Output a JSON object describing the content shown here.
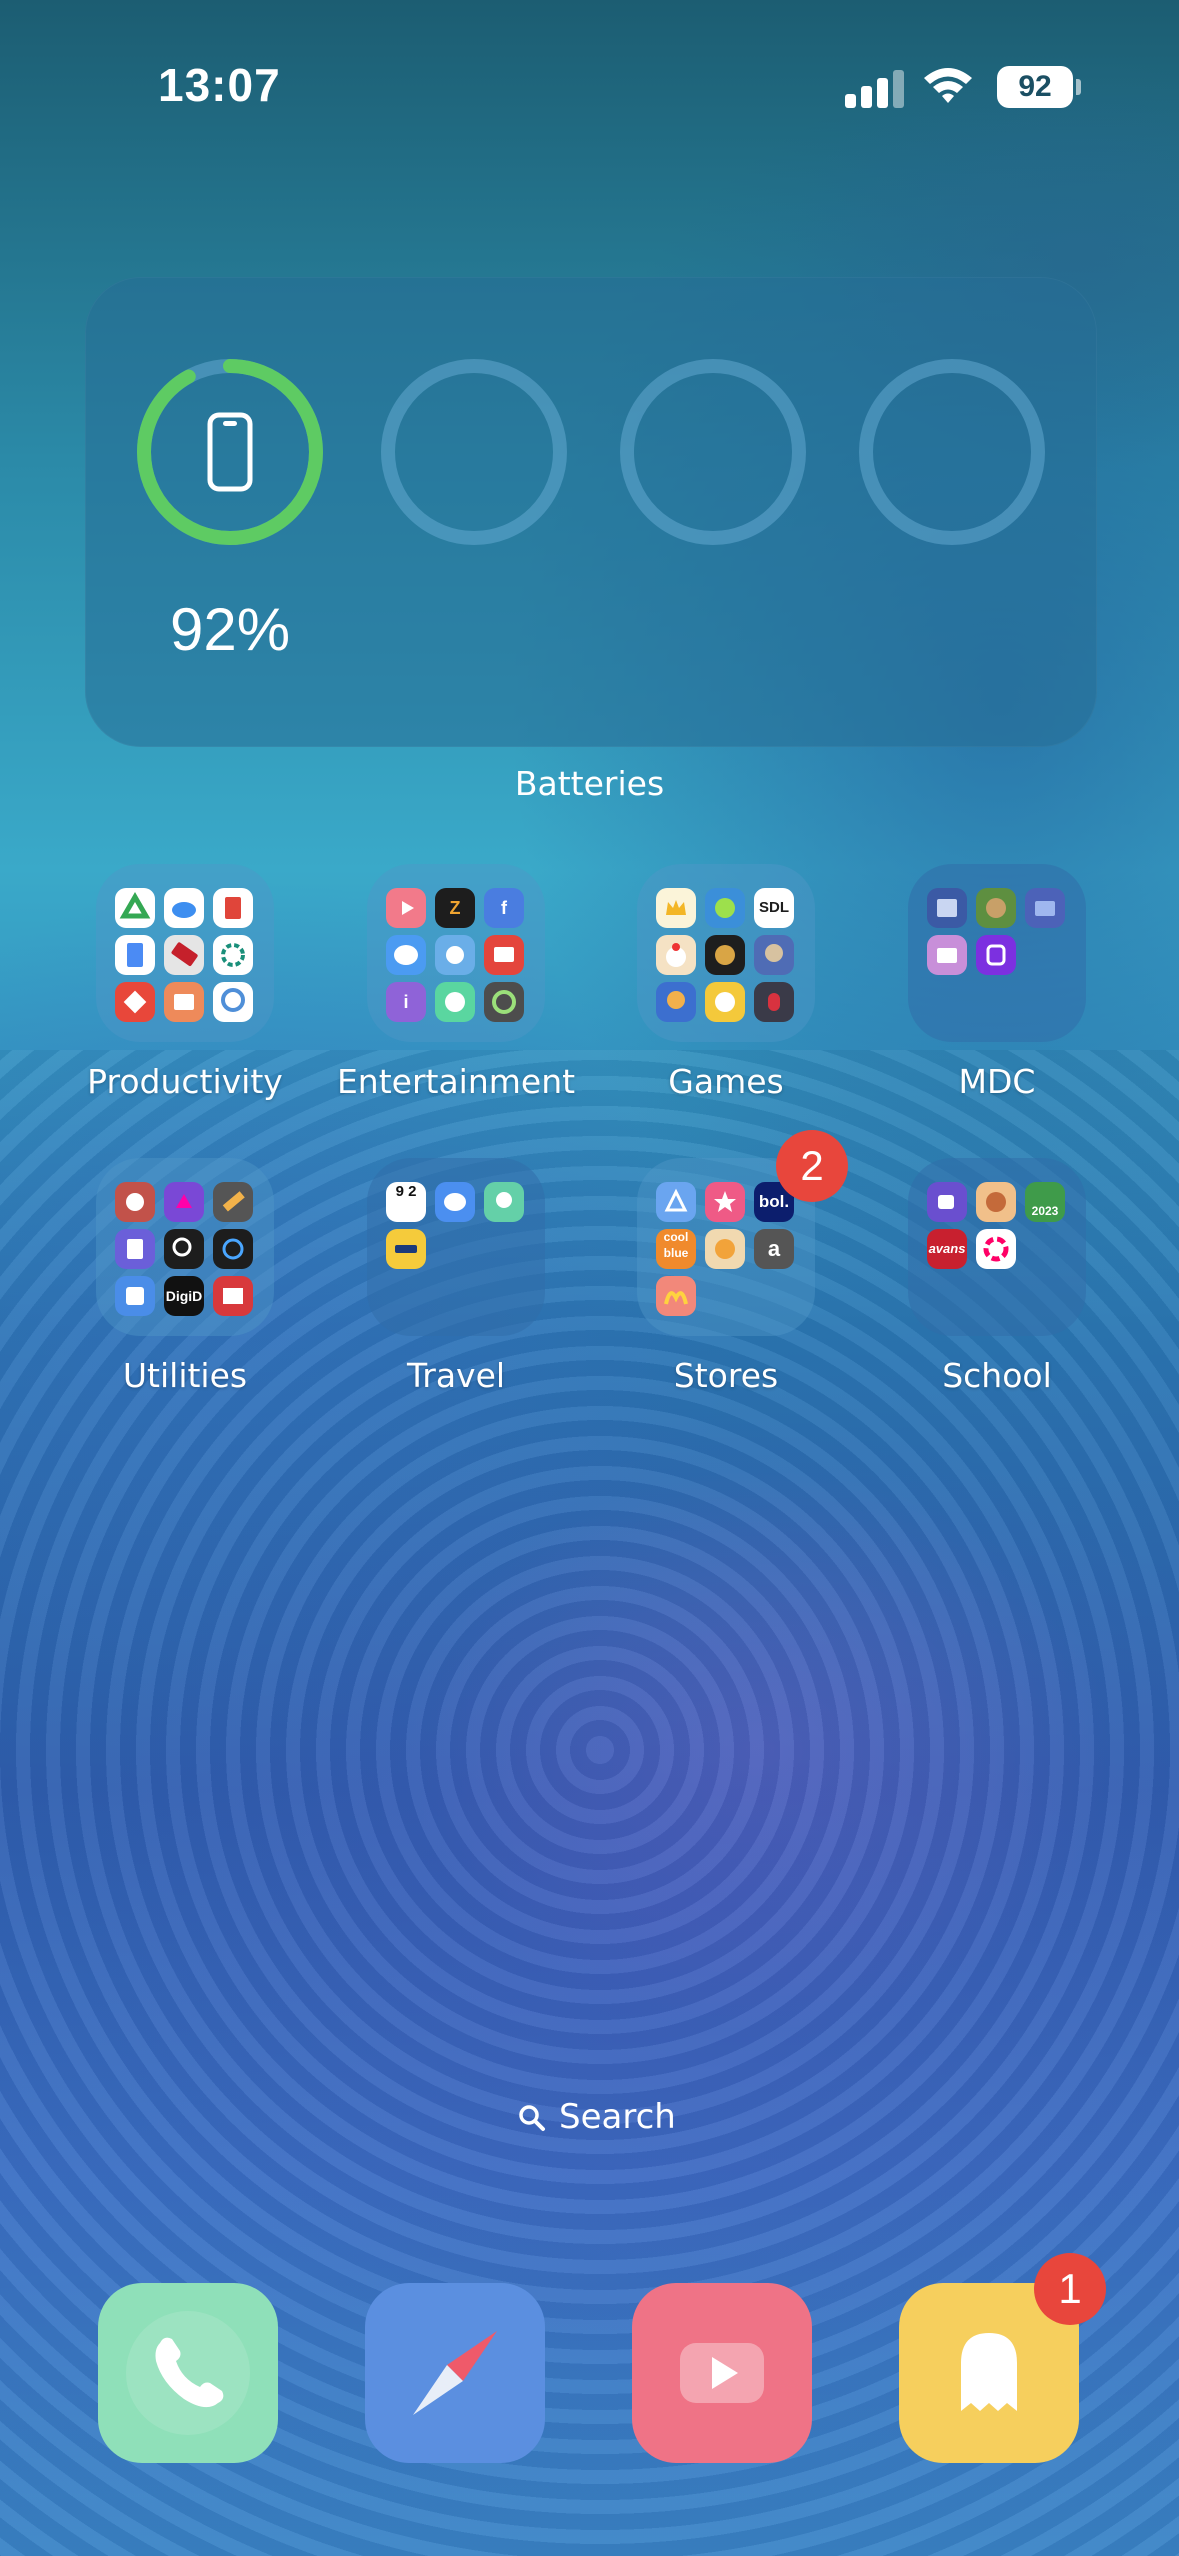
{
  "status_bar": {
    "time": "13:07",
    "battery_level": "92",
    "signal_icon": "cellular-signal-icon",
    "wifi_icon": "wifi-icon"
  },
  "widget": {
    "title": "Batteries",
    "device_percent_label": "92%",
    "device_charge": 0.92,
    "device_icon": "iphone-icon",
    "ring_color": "#5ecb63",
    "empty_slots": 3
  },
  "folders": [
    {
      "name": "Productivity"
    },
    {
      "name": "Entertainment"
    },
    {
      "name": "Games"
    },
    {
      "name": "MDC"
    },
    {
      "name": "Utilities"
    },
    {
      "name": "Travel"
    },
    {
      "name": "Stores",
      "badge": "2"
    },
    {
      "name": "School"
    }
  ],
  "mini_labels": {
    "sdl": "SDL",
    "bol": "bol.",
    "coolblue": "cool blue",
    "amazon": "a",
    "digid": "DigiD",
    "avans": "avans",
    "year": "2023",
    "z": "Z",
    "f": "f",
    "i": "i",
    "n92": "9 2"
  },
  "search": {
    "label": "Search",
    "icon": "magnifier-icon"
  },
  "dock": [
    {
      "name": "Phone",
      "icon": "phone-icon",
      "color": "#8fe0b9"
    },
    {
      "name": "Safari",
      "icon": "compass-icon",
      "color": "#5b8fe0"
    },
    {
      "name": "YouTube",
      "icon": "play-icon",
      "color": "#ef7386"
    },
    {
      "name": "Snapchat",
      "icon": "ghost-icon",
      "color": "#f6cf5d",
      "badge": "1"
    }
  ]
}
